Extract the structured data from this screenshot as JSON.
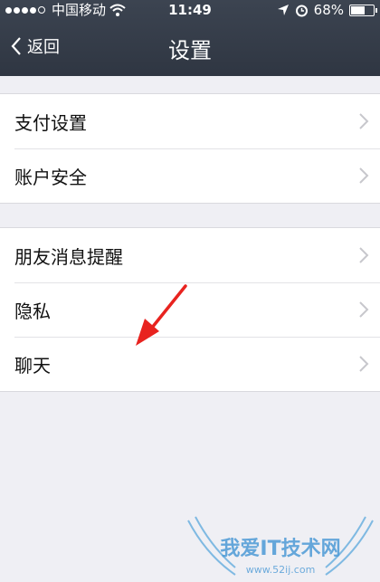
{
  "status": {
    "carrier": "中国移动",
    "time": "11:49",
    "battery": "68%",
    "battery_level": 0.68
  },
  "nav": {
    "back_label": "返回",
    "title": "设置"
  },
  "groups": [
    {
      "items": [
        {
          "label": "支付设置"
        },
        {
          "label": "账户安全"
        }
      ]
    },
    {
      "items": [
        {
          "label": "朋友消息提醒"
        },
        {
          "label": "隐私"
        },
        {
          "label": "聊天"
        }
      ]
    }
  ],
  "watermark": {
    "text": "我爱IT技术网",
    "url": "www.52ij.com"
  },
  "colors": {
    "header": "#2f3642",
    "background": "#efeff4",
    "arrow": "#e8231f"
  }
}
